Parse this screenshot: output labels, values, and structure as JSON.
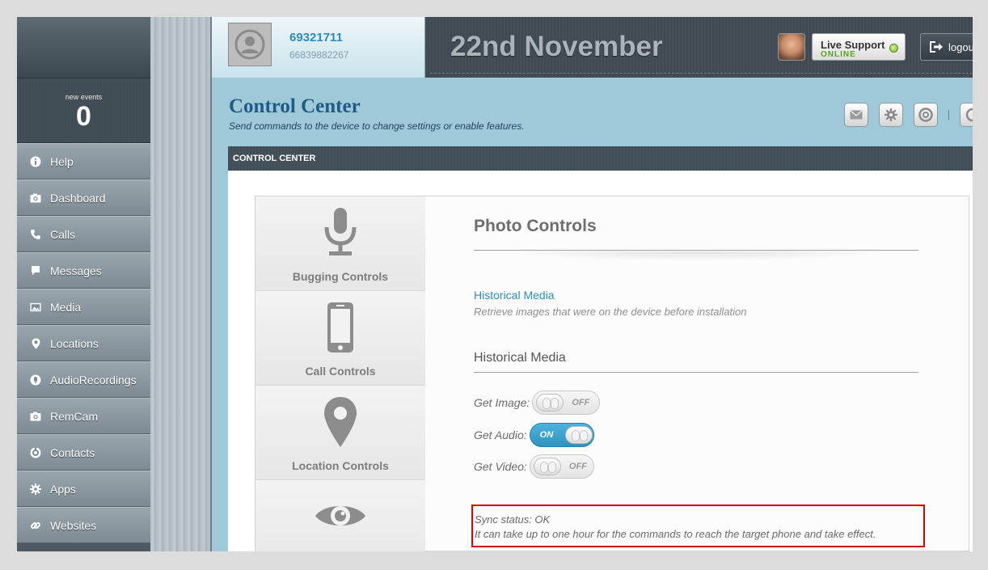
{
  "sidebar": {
    "events_label": "new events",
    "events_count": "0",
    "items": [
      {
        "label": "Help",
        "icon": "info-icon"
      },
      {
        "label": "Dashboard",
        "icon": "camera-icon"
      },
      {
        "label": "Calls",
        "icon": "phone-icon"
      },
      {
        "label": "Messages",
        "icon": "speech-bubble-icon"
      },
      {
        "label": "Media",
        "icon": "image-icon"
      },
      {
        "label": "Locations",
        "icon": "map-pin-icon"
      },
      {
        "label": "AudioRecordings",
        "icon": "microphone-icon"
      },
      {
        "label": "RemCam",
        "icon": "camera-icon"
      },
      {
        "label": "Contacts",
        "icon": "contact-icon"
      },
      {
        "label": "Apps",
        "icon": "gear-icon"
      },
      {
        "label": "Websites",
        "icon": "link-icon"
      }
    ]
  },
  "header": {
    "user_id": "69321711",
    "user_phone": "66839882267",
    "date": "22nd November",
    "live_support_label": "Live Support",
    "live_support_status": "ONLINE",
    "logout_label": "logout"
  },
  "page": {
    "title": "Control Center",
    "subtitle": "Send commands to the device to change settings or enable features.",
    "toolbar_icons": [
      "mail-icon",
      "gear-icon",
      "at-icon",
      "partial-icon"
    ],
    "panel_title": "CONTROL CENTER"
  },
  "tabs": [
    {
      "label": "Bugging Controls",
      "icon": "microphone-icon"
    },
    {
      "label": "Call Controls",
      "icon": "phone-device-icon"
    },
    {
      "label": "Location Controls",
      "icon": "map-pin-icon"
    },
    {
      "label": "",
      "icon": "eye-icon"
    }
  ],
  "main": {
    "heading": "Photo Controls",
    "link": "Historical Media",
    "link_desc": "Retrieve images that were on the device before installation",
    "section": "Historical Media",
    "toggles": [
      {
        "label": "Get Image:",
        "state": "OFF"
      },
      {
        "label": "Get Audio:",
        "state": "ON"
      },
      {
        "label": "Get Video:",
        "state": "OFF"
      }
    ],
    "sync_status": "Sync status: OK",
    "sync_note": "It can take up to one hour for the commands to reach the target phone and take effect."
  },
  "colors": {
    "accent": "#2c8fb6",
    "toggle_on": "#3aa3cf",
    "highlight_border": "#d60000",
    "online": "#5aa21e"
  }
}
